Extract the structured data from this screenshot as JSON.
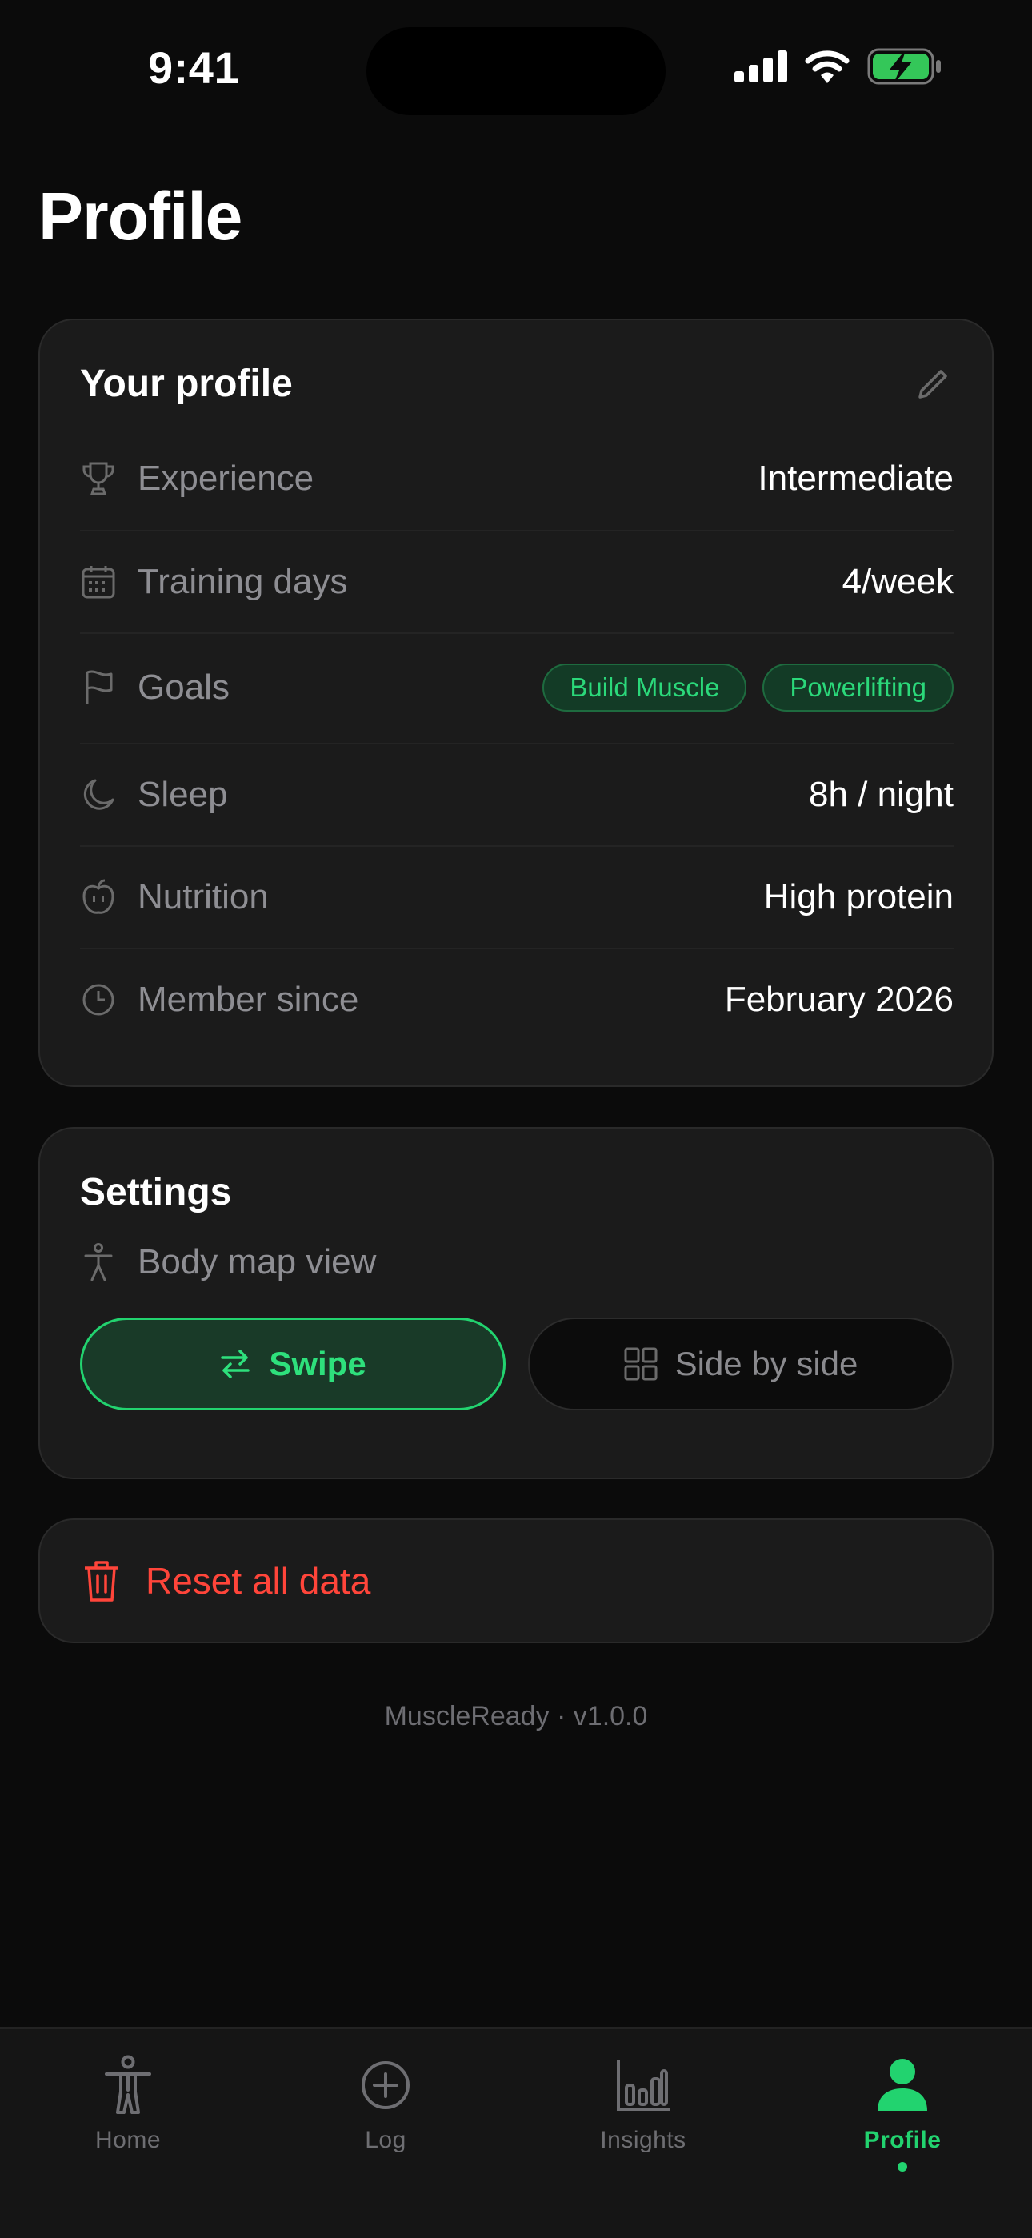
{
  "status_bar": {
    "time": "9:41"
  },
  "page": {
    "title": "Profile"
  },
  "profile_card": {
    "title": "Your profile",
    "rows": [
      {
        "label": "Experience",
        "value": "Intermediate",
        "icon": "trophy-icon"
      },
      {
        "label": "Training days",
        "value": "4/week",
        "icon": "calendar-icon"
      },
      {
        "label": "Goals",
        "icon": "flag-icon",
        "chips": [
          "Build Muscle",
          "Powerlifting"
        ]
      },
      {
        "label": "Sleep",
        "value": "8h / night",
        "icon": "moon-icon"
      },
      {
        "label": "Nutrition",
        "value": "High protein",
        "icon": "apple-icon"
      },
      {
        "label": "Member since",
        "value": "February 2026",
        "icon": "clock-icon"
      }
    ]
  },
  "settings_card": {
    "title": "Settings",
    "body_map_label": "Body map view",
    "options": [
      {
        "label": "Swipe",
        "selected": true,
        "icon": "swap-arrows-icon"
      },
      {
        "label": "Side by side",
        "selected": false,
        "icon": "grid-icon"
      }
    ]
  },
  "reset": {
    "label": "Reset all data",
    "icon": "trash-icon"
  },
  "footer": {
    "version": "MuscleReady · v1.0.0"
  },
  "tab_bar": {
    "tabs": [
      {
        "label": "Home",
        "icon": "body-icon",
        "active": false
      },
      {
        "label": "Log",
        "icon": "plus-circle-icon",
        "active": false
      },
      {
        "label": "Insights",
        "icon": "bar-chart-icon",
        "active": false
      },
      {
        "label": "Profile",
        "icon": "person-icon",
        "active": true
      }
    ]
  },
  "colors": {
    "accent": "#22d36f",
    "danger": "#ff453a",
    "card_bg": "#1b1b1b",
    "background": "#0b0b0b"
  }
}
